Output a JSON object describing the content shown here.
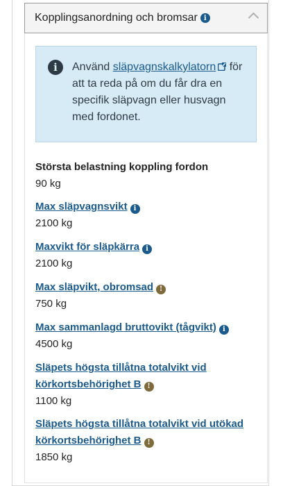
{
  "accordion": {
    "title": "Kopplingsanordning och bromsar"
  },
  "notice": {
    "prefix": "Använd ",
    "link_text": "släpvagnskalkylatorn",
    "suffix": " för att ta reda på om du får dra en specifik släpvagn eller husvagn med fordonet."
  },
  "specs": [
    {
      "label": "Största belastning koppling fordon",
      "value": "90 kg",
      "link": false,
      "icon": "none"
    },
    {
      "label": "Max släpvagnsvikt",
      "value": "2100 kg",
      "link": true,
      "icon": "info-blue"
    },
    {
      "label": "Maxvikt för släpkärra",
      "value": "2100 kg",
      "link": true,
      "icon": "info-blue"
    },
    {
      "label": "Max släpvikt, obromsad",
      "value": "750 kg",
      "link": true,
      "icon": "info-brown"
    },
    {
      "label": "Max sammanlagd bruttovikt (tågvikt)",
      "value": "4500 kg",
      "link": true,
      "icon": "info-blue"
    },
    {
      "label": "Släpets högsta tillåtna totalvikt vid körkortsbehörighet B",
      "value": "1100 kg",
      "link": true,
      "icon": "info-brown"
    },
    {
      "label": "Släpets högsta tillåtna totalvikt vid utökad körkortsbehörighet B",
      "value": "1850 kg",
      "link": true,
      "icon": "info-brown"
    }
  ],
  "colors": {
    "link": "#1a5a8c",
    "notice_bg": "#d7ebf6",
    "icon_blue": "#1a5a8c",
    "icon_brown": "#7f6a3b"
  }
}
